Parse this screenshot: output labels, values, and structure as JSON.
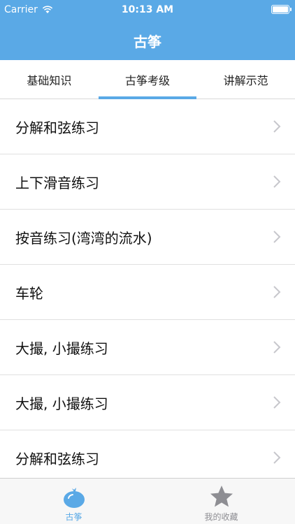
{
  "status_bar": {
    "carrier": "Carrier",
    "time": "10:13 AM"
  },
  "nav": {
    "title": "古筝"
  },
  "tabs": [
    {
      "label": "基础知识",
      "active": false
    },
    {
      "label": "古筝考级",
      "active": true
    },
    {
      "label": "讲解示范",
      "active": false
    }
  ],
  "list": [
    {
      "label": "分解和弦练习"
    },
    {
      "label": "上下滑音练习"
    },
    {
      "label": "按音练习(湾湾的流水)"
    },
    {
      "label": "车轮"
    },
    {
      "label": "大撮, 小撮练习"
    },
    {
      "label": "大撮, 小撮练习"
    },
    {
      "label": "分解和弦练习"
    }
  ],
  "tabbar": [
    {
      "label": "古筝",
      "icon": "tomato-icon",
      "active": true
    },
    {
      "label": "我的收藏",
      "icon": "star-icon",
      "active": false
    }
  ],
  "colors": {
    "accent": "#5aa9e6"
  }
}
